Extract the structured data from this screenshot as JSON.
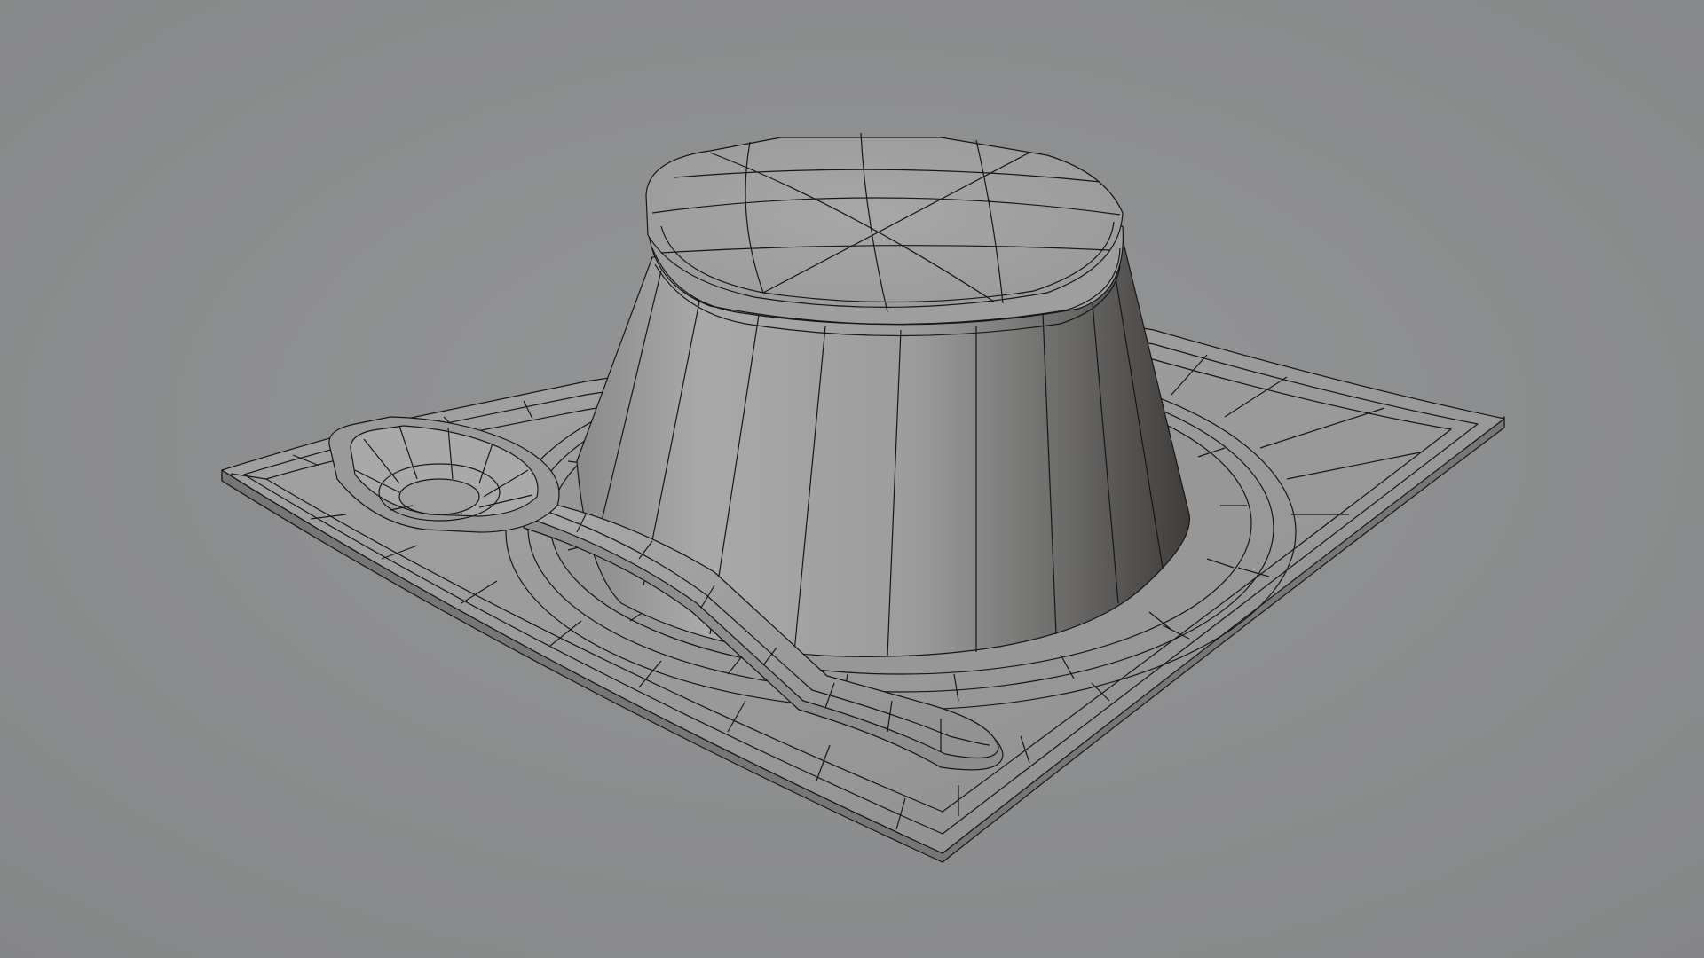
{
  "scene": {
    "subject": "3d-viewport-render",
    "objects": [
      "plate",
      "pudding",
      "spoon"
    ],
    "display_mode": "solid-with-wireframe",
    "colors": {
      "background": "#8f9091",
      "plate_top": "#9a9a9a",
      "plate_edge": "#7b7b7b",
      "pudding_light": "#a6a6a6",
      "pudding_dark": "#4a4744",
      "wire": "#161616"
    }
  }
}
